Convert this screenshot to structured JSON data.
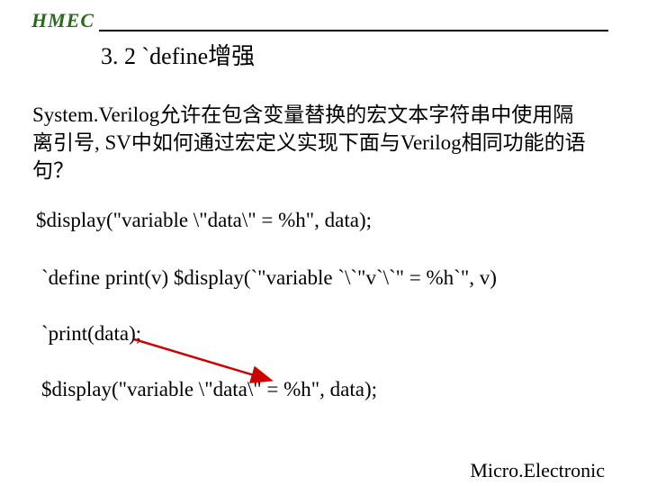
{
  "header": {
    "brand": "HMEC"
  },
  "title": "3. 2 `define增强",
  "paragraph": " System.Verilog允许在包含变量替换的宏文本字符串中使用隔离引号, SV中如何通过宏定义实现下面与Verilog相同功能的语句？",
  "code": {
    "line1": "$display(\"variable \\\"data\\\" = %h\", data);",
    "line2": "`define print(v)  $display(`\"variable `\\`\"v`\\`\" = %h`\", v)",
    "line3": "`print(data);",
    "line4": "$display(\"variable \\\"data\\\" = %h\", data);"
  },
  "footer": {
    "org": "Micro.Electronic"
  }
}
